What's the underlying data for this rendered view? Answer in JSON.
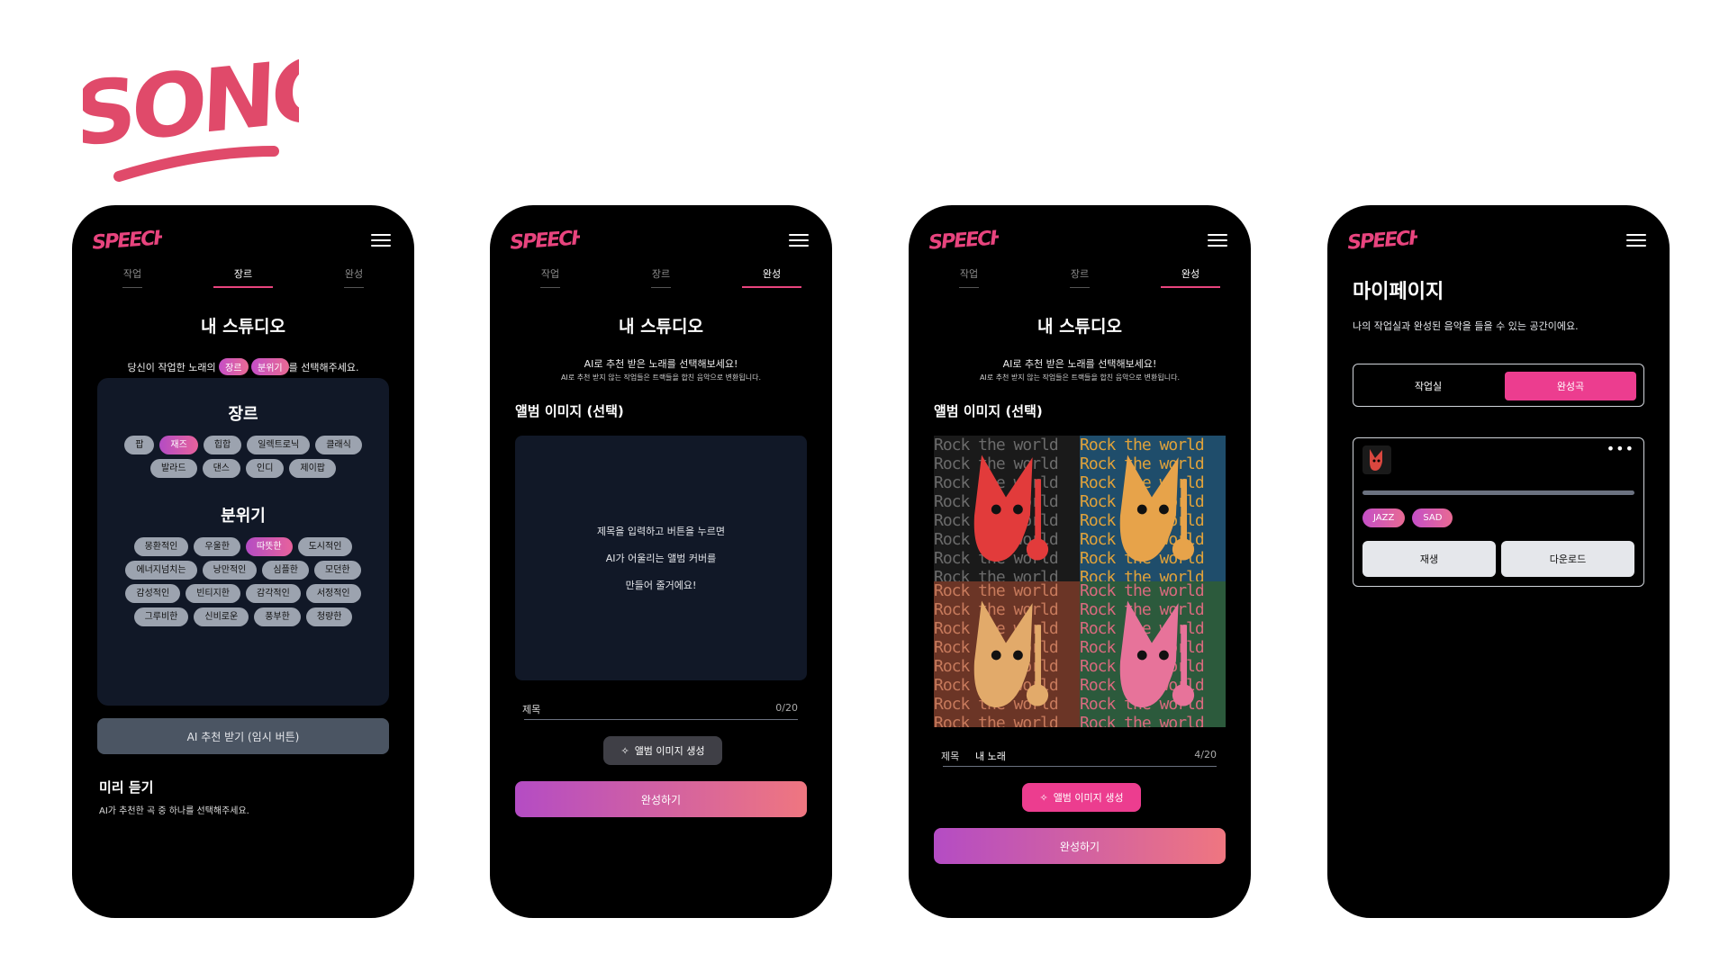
{
  "logo": {
    "text": "SONG",
    "color": "#e04a6a"
  },
  "brand": {
    "text": "SPEECHFY",
    "color": "#e8447e"
  },
  "tabs": [
    "작업",
    "장르",
    "완성"
  ],
  "phone1": {
    "title": "내 스튜디오",
    "sub_prefix": "당신이 작업한 노래의",
    "sub_pill1": "장르",
    "sub_pill2": "분위기",
    "sub_suffix": "를 선택해주세요.",
    "genre_heading": "장르",
    "genres": [
      "팝",
      "재즈",
      "힙합",
      "일렉트로닉",
      "클래식",
      "발라드",
      "댄스",
      "인디",
      "제이팝"
    ],
    "mood_heading": "분위기",
    "moods": [
      "몽환적인",
      "우울한",
      "따뜻한",
      "도시적인",
      "에너지넘치는",
      "낭만적인",
      "심플한",
      "모던한",
      "감성적인",
      "빈티지한",
      "감각적인",
      "서정적인",
      "그루비한",
      "신비로운",
      "풍부한",
      "청량한"
    ],
    "ai_button": "AI 추천 받기 (임시 버튼)",
    "preview_heading": "미리 듣기",
    "preview_sub": "AI가 추천한 곡 중 하나를 선택해주세요."
  },
  "phone2": {
    "title": "내 스튜디오",
    "sub": "AI로 추천 받은 노래를 선택해보세요!",
    "note": "AI로 추천 받지 않는 작업들은 트랙들을 합친 음악으로 변환됩니다.",
    "album_heading": "앨범 이미지 (선택)",
    "placeholder_lines": [
      "제목을 입력하고 버튼을 누르면",
      "AI가 어울리는 앨범 커버를",
      "만들어 줄거에요!"
    ],
    "title_label": "제목",
    "title_value": "",
    "title_count": "0/20",
    "gen_button": "앨범 이미지 생성",
    "finish_button": "완성하기"
  },
  "phone3": {
    "title": "내 스튜디오",
    "sub": "AI로 추천 받은 노래를 선택해보세요!",
    "note": "AI로 추천 받지 않는 작업들은 트랙들을 합친 음악으로 변환됩니다.",
    "album_heading": "앨범 이미지 (선택)",
    "art_text": "Rock the world",
    "title_label": "제목",
    "title_value": "내 노래",
    "title_count": "4/20",
    "gen_button": "앨범 이미지 생성",
    "finish_button": "완성하기"
  },
  "phone4": {
    "title": "마이페이지",
    "sub": "나의 작업실과 완성된 음악을 들을 수 있는 공간이에요.",
    "seg_left": "작업실",
    "seg_right": "완성곡",
    "more": "•••",
    "tags": [
      "JAZZ",
      "SAD"
    ],
    "play_button": "재생",
    "download_button": "다운로드"
  },
  "colors": {
    "accent": "#ec3d8f",
    "card": "#111827",
    "chip": "#9ca3af"
  }
}
